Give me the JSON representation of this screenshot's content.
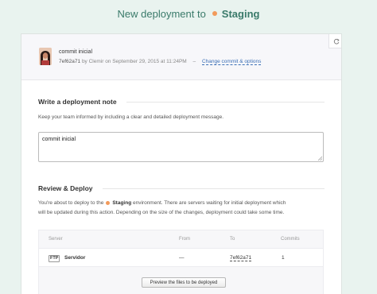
{
  "header": {
    "prefix": "New deployment to",
    "environment": "Staging",
    "env_color": "#f29a5b"
  },
  "commit": {
    "message": "commit inicial",
    "sha": "7ef62a71",
    "by_line": "by Clemir on September 29, 2015 at 11:24PM",
    "separator": "–",
    "change_link": "Change commit & options",
    "refresh_icon": "refresh-icon"
  },
  "note_section": {
    "title": "Write a deployment note",
    "description": "Keep your team informed by including a clear and detailed deployment message.",
    "note_value": "commit inicial"
  },
  "review_section": {
    "title": "Review & Deploy",
    "desc_before": "You're about to deploy to the",
    "environment": "Staging",
    "desc_after_line1": "environment. There are servers waiting for initial deployment which",
    "desc_line2": "will be updated during this action. Depending on the size of the changes, deployment could take some time."
  },
  "servers_table": {
    "columns": [
      "Server",
      "From",
      "To",
      "Commits"
    ],
    "rows": [
      {
        "protocol": "FTP",
        "server": "Servidor",
        "from": "—",
        "to": "7ef62a71",
        "commits": "1"
      }
    ],
    "preview_button": "Preview the files to be deployed"
  },
  "colors": {
    "accent": "#3a7a6a",
    "link": "#3b6fb6",
    "background": "#e9f3ef"
  }
}
